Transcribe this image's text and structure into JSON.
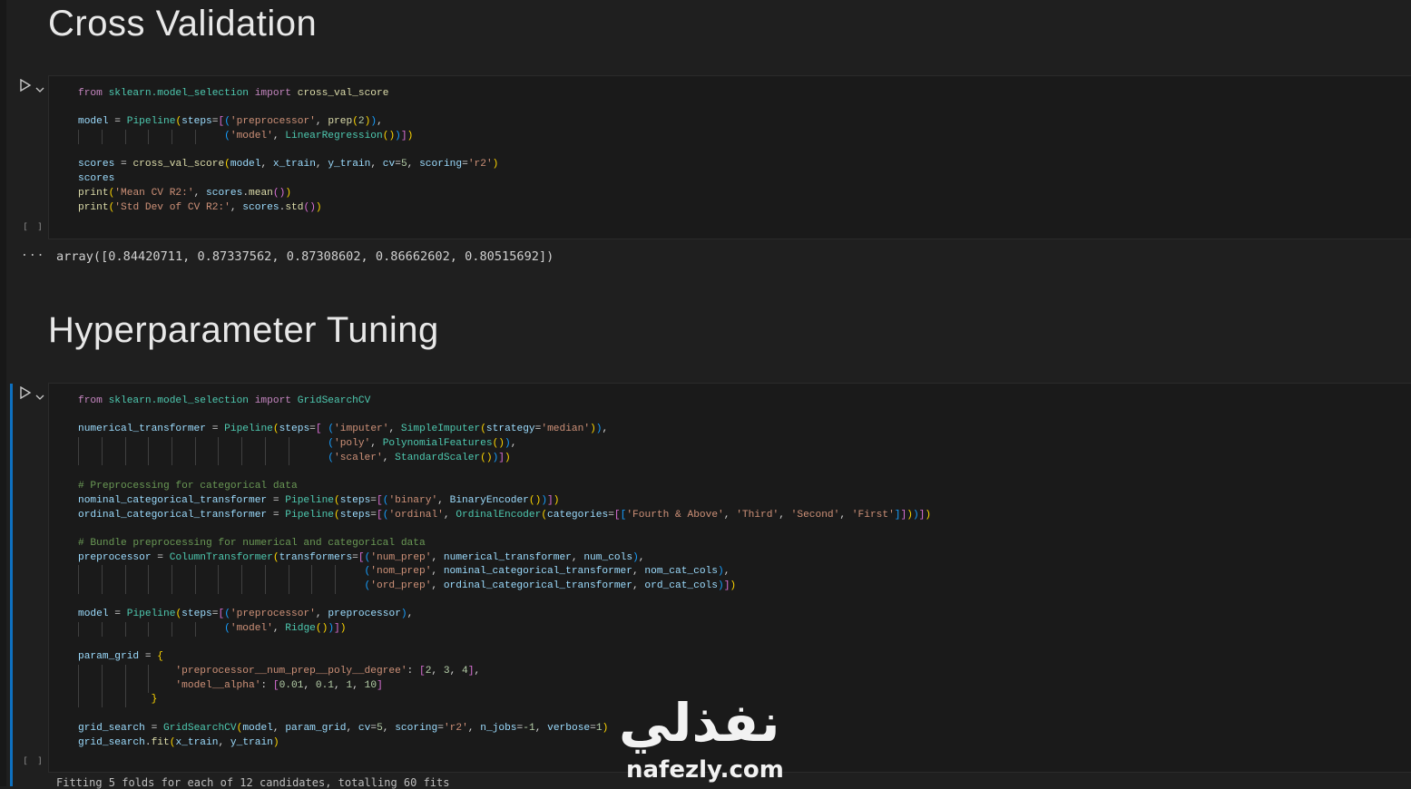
{
  "headings": {
    "cross_validation": "Cross Validation",
    "hyperparameter_tuning": "Hyperparameter Tuning"
  },
  "cells": [
    {
      "exec_label": "[ ]",
      "code_lines": [
        "from sklearn.model_selection import cross_val_score",
        "",
        "model = Pipeline(steps=[('preprocessor', prep(2)),",
        "                        ('model', LinearRegression())])",
        "",
        "scores = cross_val_score(model, x_train, y_train, cv=5, scoring='r2')",
        "scores",
        "print('Mean CV R2:', scores.mean())",
        "print('Std Dev of CV R2:', scores.std())"
      ],
      "output_marker": "...",
      "output": "array([0.84420711, 0.87337562, 0.87308602, 0.86662602, 0.80515692])"
    },
    {
      "exec_label": "[ ]",
      "code_lines": [
        "from sklearn.model_selection import GridSearchCV",
        "",
        "numerical_transformer = Pipeline(steps=[ ('imputer', SimpleImputer(strategy='median')),",
        "                                         ('poly', PolynomialFeatures()),",
        "                                         ('scaler', StandardScaler())])",
        "",
        "# Preprocessing for categorical data",
        "nominal_categorical_transformer = Pipeline(steps=[('binary', BinaryEncoder())])",
        "ordinal_categorical_transformer = Pipeline(steps=[('ordinal', OrdinalEncoder(categories=[['Fourth & Above', 'Third', 'Second', 'First']]))])",
        "",
        "# Bundle preprocessing for numerical and categorical data",
        "preprocessor = ColumnTransformer(transformers=[('num_prep', numerical_transformer, num_cols),",
        "                                               ('nom_prep', nominal_categorical_transformer, nom_cat_cols),",
        "                                               ('ord_prep', ordinal_categorical_transformer, ord_cat_cols)])",
        "",
        "model = Pipeline(steps=[('preprocessor', preprocessor),",
        "                        ('model', Ridge())])",
        "",
        "param_grid = {",
        "                'preprocessor__num_prep__poly__degree': [2, 3, 4],",
        "                'model__alpha': [0.01, 0.1, 1, 10]",
        "            }",
        "",
        "grid_search = GridSearchCV(model, param_grid, cv=5, scoring='r2', n_jobs=-1, verbose=1)",
        "grid_search.fit(x_train, y_train)"
      ]
    }
  ],
  "watermark": {
    "arabic": "نفذلي",
    "latin": "nafezly.com"
  },
  "bottom_partial_output": "Fitting 5 folds for each of 12 candidates, totalling 60 fits"
}
